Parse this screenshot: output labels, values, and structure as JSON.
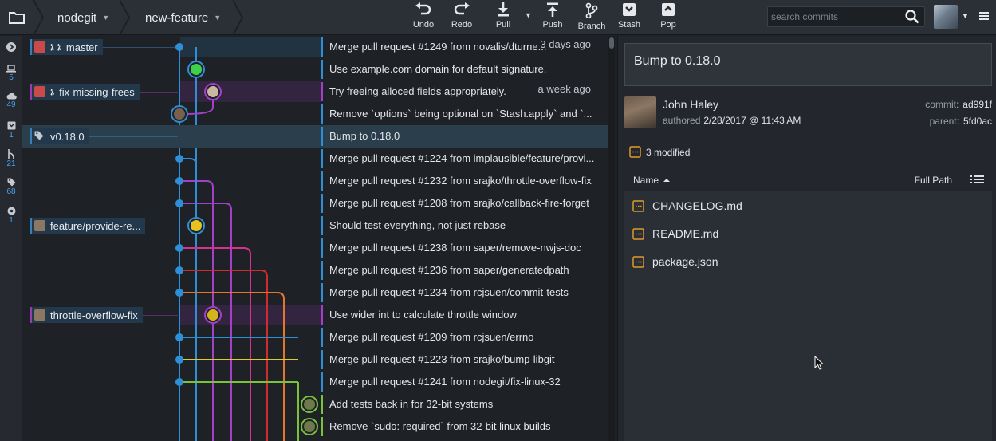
{
  "toolbar": {
    "repo": "nodegit",
    "branch": "new-feature",
    "buttons": [
      {
        "id": "undo",
        "label": "Undo",
        "icon": "undo-icon"
      },
      {
        "id": "redo",
        "label": "Redo",
        "icon": "redo-icon"
      },
      {
        "id": "pull",
        "label": "Pull",
        "icon": "pull-icon"
      },
      {
        "id": "push",
        "label": "Push",
        "icon": "push-icon"
      },
      {
        "id": "branch",
        "label": "Branch",
        "icon": "branch-icon"
      },
      {
        "id": "stash",
        "label": "Stash",
        "icon": "stash-icon"
      },
      {
        "id": "pop",
        "label": "Pop",
        "icon": "pop-icon"
      }
    ],
    "search_placeholder": "search commits"
  },
  "sidebar": {
    "items": [
      {
        "icon": "chevron-right-icon",
        "count": ""
      },
      {
        "icon": "laptop-icon",
        "count": "5"
      },
      {
        "icon": "cloud-icon",
        "count": "49"
      },
      {
        "icon": "inbox-icon",
        "count": "1"
      },
      {
        "icon": "branch-icon",
        "count": "21"
      },
      {
        "icon": "tag-icon",
        "count": "68"
      },
      {
        "icon": "submodule-icon",
        "count": "1"
      }
    ]
  },
  "branch_labels": [
    {
      "name": "master",
      "icon": "branch-badge",
      "prefix": "ኔ ኔ",
      "color": "#3a7dbb"
    },
    {
      "name": "fix-missing-frees",
      "icon": "branch-badge",
      "prefix": "ኔ",
      "color": "#9b3bb4"
    },
    {
      "name": "v0.18.0",
      "icon": "tag-icon",
      "prefix": "",
      "color": "#3a7dbb"
    },
    {
      "name": "feature/provide-re...",
      "icon": "avatar-badge",
      "prefix": "",
      "color": "#3a7dbb"
    },
    {
      "name": "throttle-overflow-fix",
      "icon": "avatar-badge",
      "prefix": "",
      "color": "#9b3bb4"
    }
  ],
  "commits": [
    {
      "message": "Merge pull request #1249 from novalis/dturne...",
      "time": "3 days ago"
    },
    {
      "message": "Use example.com domain for default signature.",
      "time": ""
    },
    {
      "message": "Try freeing alloced fields appropriately.",
      "time": "a week ago"
    },
    {
      "message": "Remove `options` being optional on `Stash.apply` and `...",
      "time": ""
    },
    {
      "message": "Bump to 0.18.0",
      "time": ""
    },
    {
      "message": "Merge pull request #1224 from implausible/feature/provi...",
      "time": ""
    },
    {
      "message": "Merge pull request #1232 from srajko/throttle-overflow-fix",
      "time": ""
    },
    {
      "message": "Merge pull request #1208 from srajko/callback-fire-forget",
      "time": ""
    },
    {
      "message": "Should test everything, not just rebase",
      "time": ""
    },
    {
      "message": "Merge pull request #1238 from saper/remove-nwjs-doc",
      "time": ""
    },
    {
      "message": "Merge pull request #1236 from saper/generatedpath",
      "time": ""
    },
    {
      "message": "Merge pull request #1234 from rcjsuen/commit-tests",
      "time": ""
    },
    {
      "message": "Use wider int to calculate throttle window",
      "time": ""
    },
    {
      "message": "Merge pull request #1209 from rcjsuen/errno",
      "time": ""
    },
    {
      "message": "Merge pull request #1223 from srajko/bump-libgit",
      "time": ""
    },
    {
      "message": "Merge pull request #1241 from nodegit/fix-linux-32",
      "time": ""
    },
    {
      "message": "Add tests back in for 32-bit systems",
      "time": ""
    },
    {
      "message": "Remove `sudo: required` from 32-bit linux builds",
      "time": ""
    }
  ],
  "detail": {
    "message": "Bump to 0.18.0",
    "author": "John Haley",
    "authored_label": "authored",
    "authored_date": "2/28/2017 @ 11:43 AM",
    "commit_label": "commit:",
    "commit_sha": "ad991f",
    "parent_label": "parent:",
    "parent_sha": "5fd0ac",
    "modified": "3 modified",
    "name_header": "Name",
    "full_path": "Full Path",
    "files": [
      "CHANGELOG.md",
      "README.md",
      "package.json"
    ]
  },
  "colors": {
    "blue": "#2f8fd6",
    "purple": "#a43fc9",
    "pink": "#d6318f",
    "red": "#d22b2b",
    "orange": "#e3762b",
    "yellow": "#e3c92b",
    "green": "#7ac23a"
  }
}
